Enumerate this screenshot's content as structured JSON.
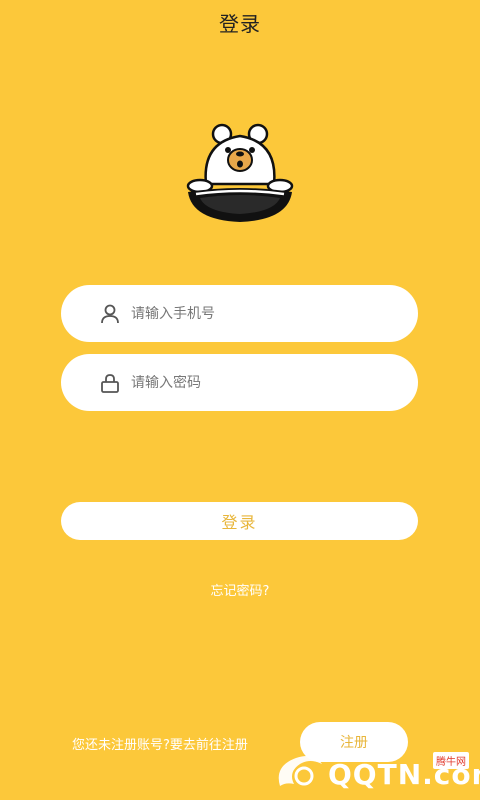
{
  "header": {
    "title": "登录"
  },
  "form": {
    "phone_placeholder": "请输入手机号",
    "password_placeholder": "请输入密码",
    "login_label": "登录",
    "forgot_label": "忘记密码?"
  },
  "footer": {
    "register_prompt": "您还未注册账号?要去前往注册",
    "register_label": "注册"
  },
  "watermark": {
    "text": "QQTN.com",
    "badge": "腾牛网"
  },
  "colors": {
    "background": "#FCC83A",
    "button_text": "#E8B63B",
    "white": "#FFFFFF"
  },
  "icons": {
    "mascot": "bear-in-wok",
    "phone": "user-icon",
    "password": "lock-icon"
  }
}
